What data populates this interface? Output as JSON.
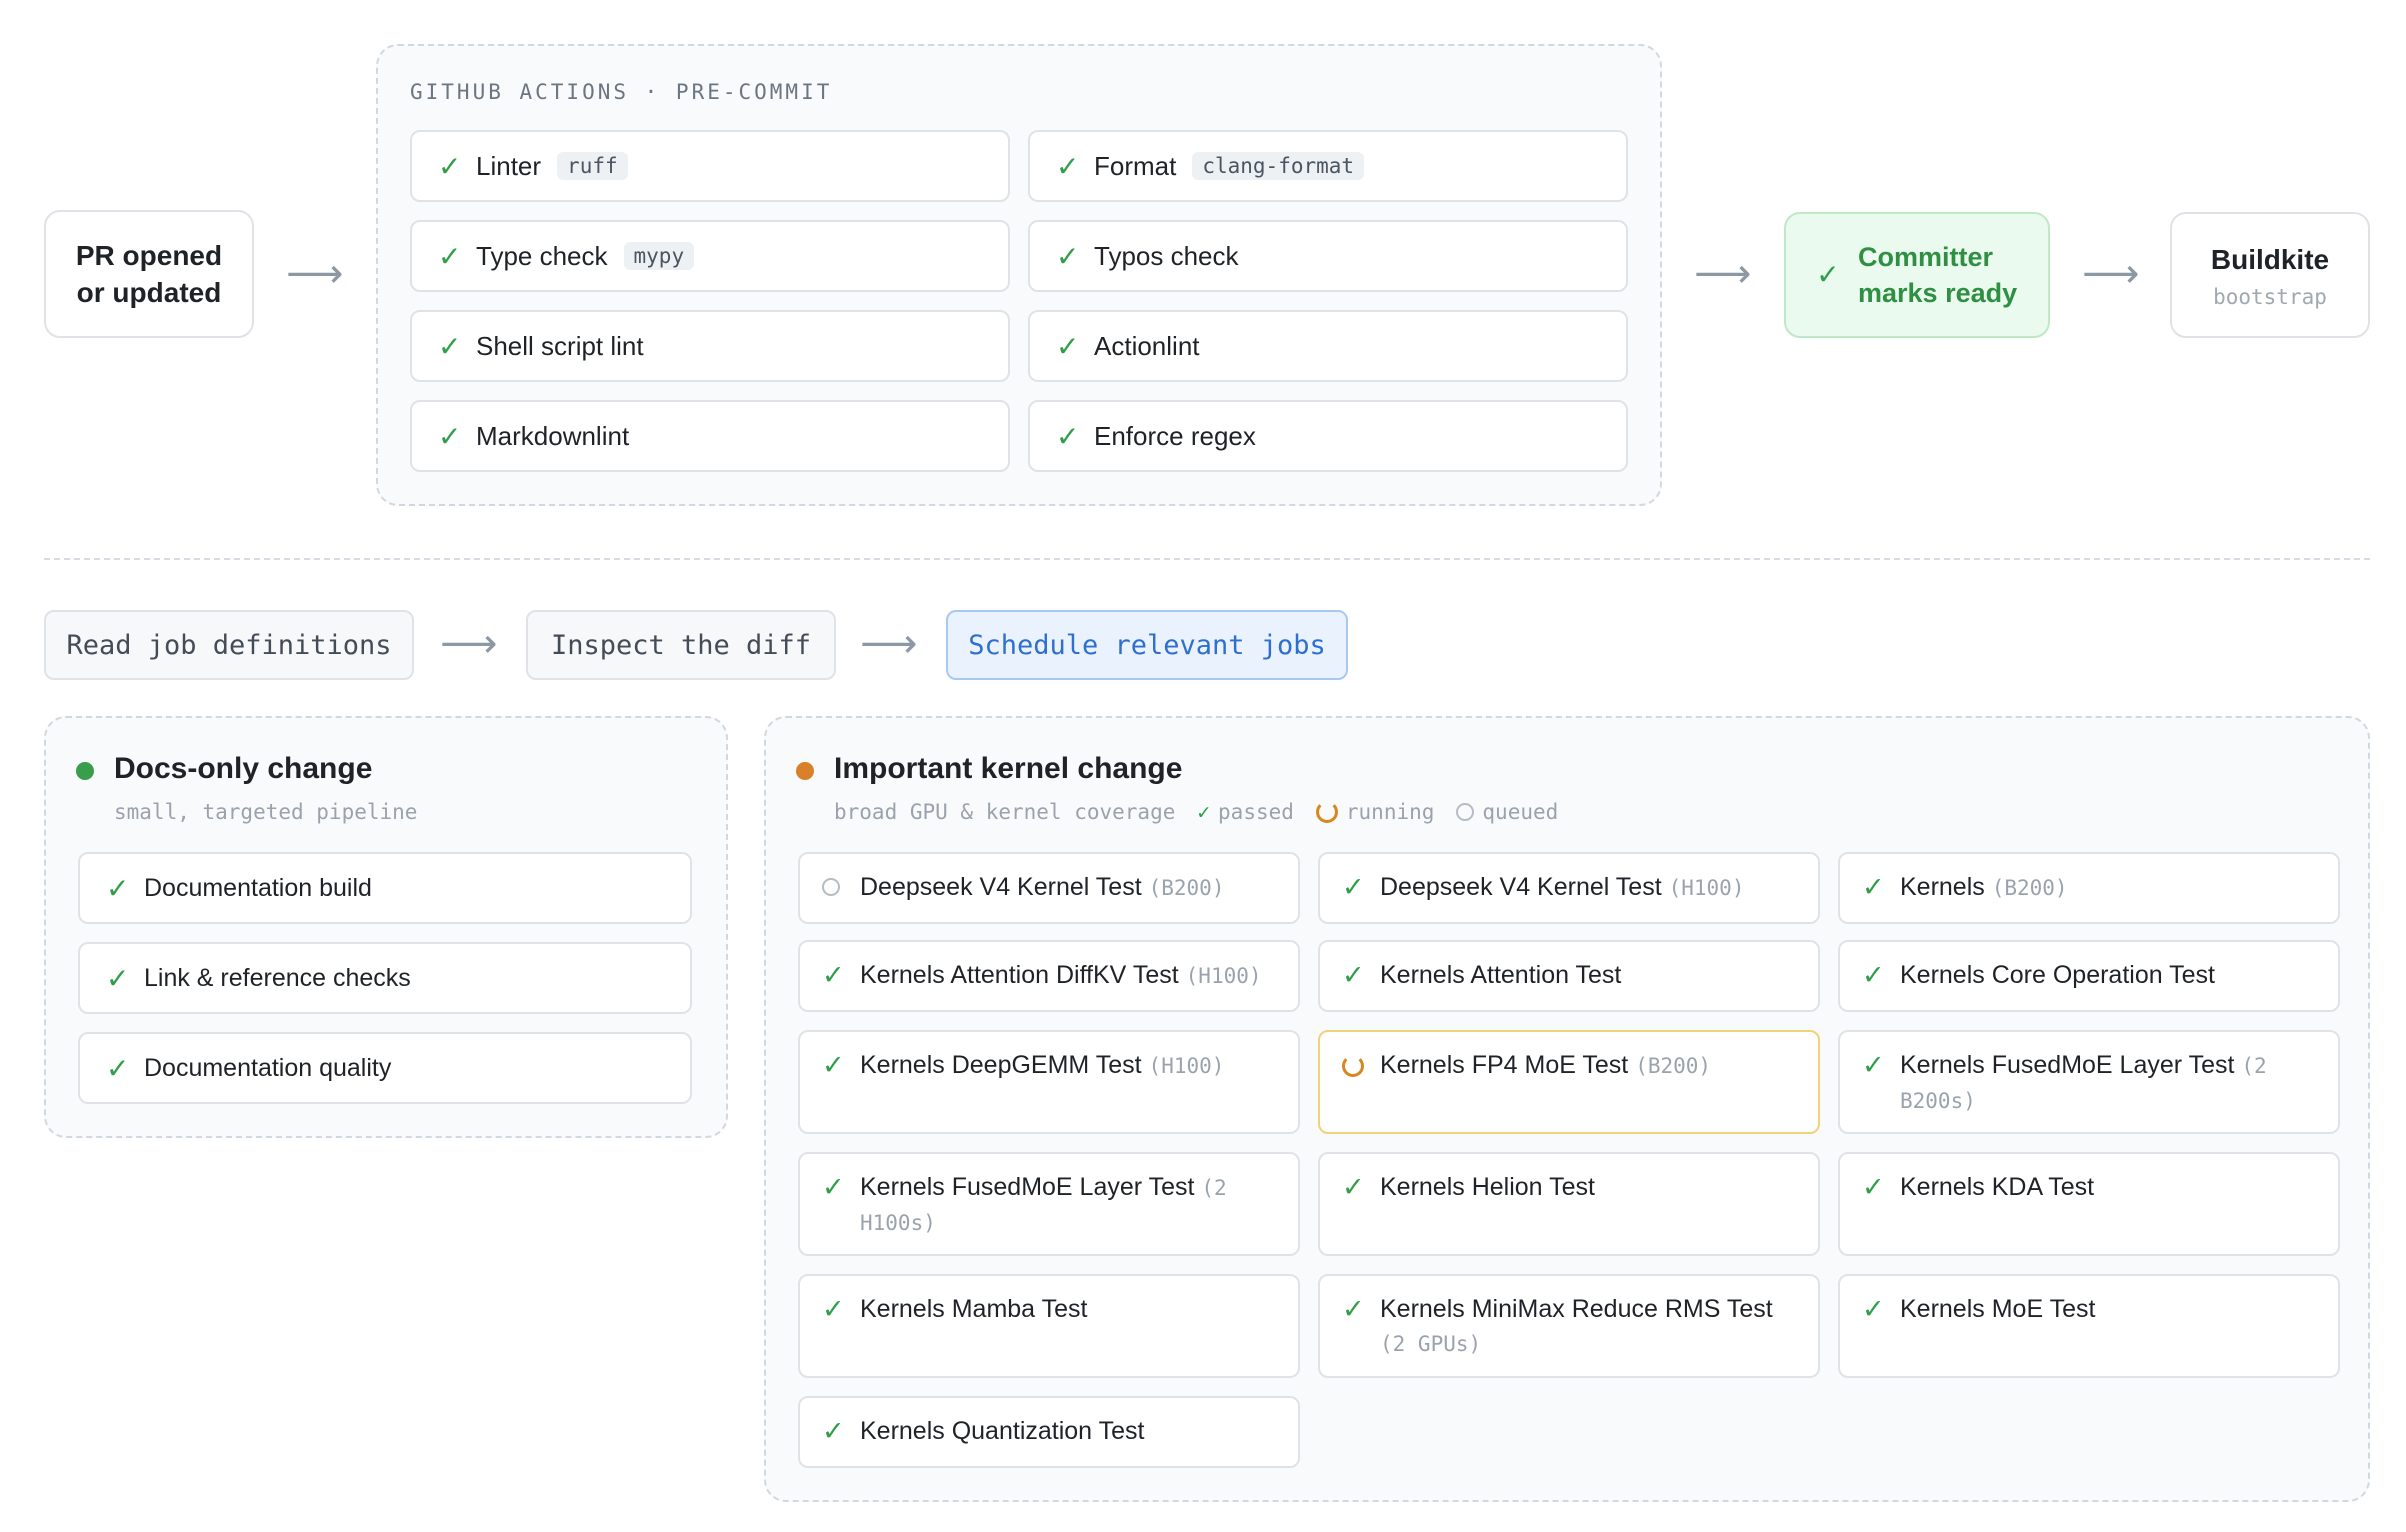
{
  "top_flow": {
    "start_node": {
      "line1": "PR opened",
      "line2": "or updated"
    },
    "precommit": {
      "header": "GITHUB ACTIONS · PRE-COMMIT",
      "checks": [
        {
          "label": "Linter",
          "tool": "ruff",
          "status": "passed"
        },
        {
          "label": "Format",
          "tool": "clang-format",
          "status": "passed"
        },
        {
          "label": "Type check",
          "tool": "mypy",
          "status": "passed"
        },
        {
          "label": "Typos check",
          "tool": "",
          "status": "passed"
        },
        {
          "label": "Shell script lint",
          "tool": "",
          "status": "passed"
        },
        {
          "label": "Actionlint",
          "tool": "",
          "status": "passed"
        },
        {
          "label": "Markdownlint",
          "tool": "",
          "status": "passed"
        },
        {
          "label": "Enforce regex",
          "tool": "",
          "status": "passed"
        }
      ]
    },
    "committer_node": {
      "line1": "Committer",
      "line2": "marks ready"
    },
    "buildkite_node": {
      "title": "Buildkite",
      "subtitle": "bootstrap"
    },
    "arrow_glyph": "⟶",
    "check_glyph": "✓"
  },
  "pipeline_steps": [
    {
      "label": "Read job definitions",
      "active": false
    },
    {
      "label": "Inspect the diff",
      "active": false
    },
    {
      "label": "Schedule relevant jobs",
      "active": true
    }
  ],
  "docs_panel": {
    "title": "Docs-only change",
    "subtitle": "small, targeted pipeline",
    "dot_color": "#3a9d4c",
    "jobs": [
      {
        "label": "Documentation build",
        "status": "passed"
      },
      {
        "label": "Link & reference checks",
        "status": "passed"
      },
      {
        "label": "Documentation quality",
        "status": "passed"
      }
    ]
  },
  "kernel_panel": {
    "title": "Important kernel change",
    "subtitle": "broad GPU & kernel coverage",
    "dot_color": "#d8812a",
    "legend": {
      "passed": "passed",
      "running": "running",
      "queued": "queued"
    },
    "jobs": [
      {
        "name": "Deepseek V4 Kernel Test",
        "gpu": "(B200)",
        "status": "queued"
      },
      {
        "name": "Deepseek V4 Kernel Test",
        "gpu": "(H100)",
        "status": "passed"
      },
      {
        "name": "Kernels",
        "gpu": "(B200)",
        "status": "passed"
      },
      {
        "name": "Kernels Attention DiffKV Test",
        "gpu": "(H100)",
        "status": "passed"
      },
      {
        "name": "Kernels Attention Test",
        "gpu": "",
        "status": "passed"
      },
      {
        "name": "Kernels Core Operation Test",
        "gpu": "",
        "status": "passed"
      },
      {
        "name": "Kernels DeepGEMM Test",
        "gpu": "(H100)",
        "status": "passed"
      },
      {
        "name": "Kernels FP4 MoE Test",
        "gpu": "(B200)",
        "status": "running"
      },
      {
        "name": "Kernels FusedMoE Layer Test",
        "gpu": "(2 B200s)",
        "status": "passed"
      },
      {
        "name": "Kernels FusedMoE Layer Test",
        "gpu": "(2 H100s)",
        "status": "passed"
      },
      {
        "name": "Kernels Helion Test",
        "gpu": "",
        "status": "passed"
      },
      {
        "name": "Kernels KDA Test",
        "gpu": "",
        "status": "passed"
      },
      {
        "name": "Kernels Mamba Test",
        "gpu": "",
        "status": "passed"
      },
      {
        "name": "Kernels MiniMax Reduce RMS Test",
        "gpu": "(2 GPUs)",
        "status": "passed"
      },
      {
        "name": "Kernels MoE Test",
        "gpu": "",
        "status": "passed"
      },
      {
        "name": "Kernels Quantization Test",
        "gpu": "",
        "status": "passed"
      }
    ]
  },
  "colors": {
    "passed": "#2f9e48",
    "running": "#d8871f",
    "queued": "#b4bcc5",
    "active_step": "#2f6fcf",
    "committer_bg": "#eafaee"
  }
}
